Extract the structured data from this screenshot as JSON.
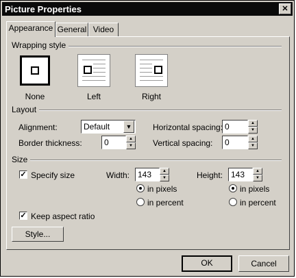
{
  "window": {
    "title": "Picture Properties",
    "close": "✕"
  },
  "tabs": [
    "Appearance",
    "General",
    "Video"
  ],
  "wrapping": {
    "heading": "Wrapping style",
    "options": [
      "None",
      "Left",
      "Right"
    ],
    "selected": "None"
  },
  "layout": {
    "heading": "Layout",
    "alignment_label": "Alignment:",
    "alignment_value": "Default",
    "border_label": "Border thickness:",
    "border_value": "0",
    "hspacing_label": "Horizontal spacing:",
    "hspacing_value": "0",
    "vspacing_label": "Vertical spacing:",
    "vspacing_value": "0"
  },
  "size": {
    "heading": "Size",
    "specify_label": "Specify size",
    "specify_checked": true,
    "width_label": "Width:",
    "width_value": "143",
    "height_label": "Height:",
    "height_value": "143",
    "in_pixels": "in pixels",
    "in_percent": "in percent",
    "width_unit": "in pixels",
    "height_unit": "in pixels",
    "keep_aspect_label": "Keep aspect ratio",
    "keep_aspect_checked": true
  },
  "buttons": {
    "style": "Style...",
    "ok": "OK",
    "cancel": "Cancel"
  }
}
